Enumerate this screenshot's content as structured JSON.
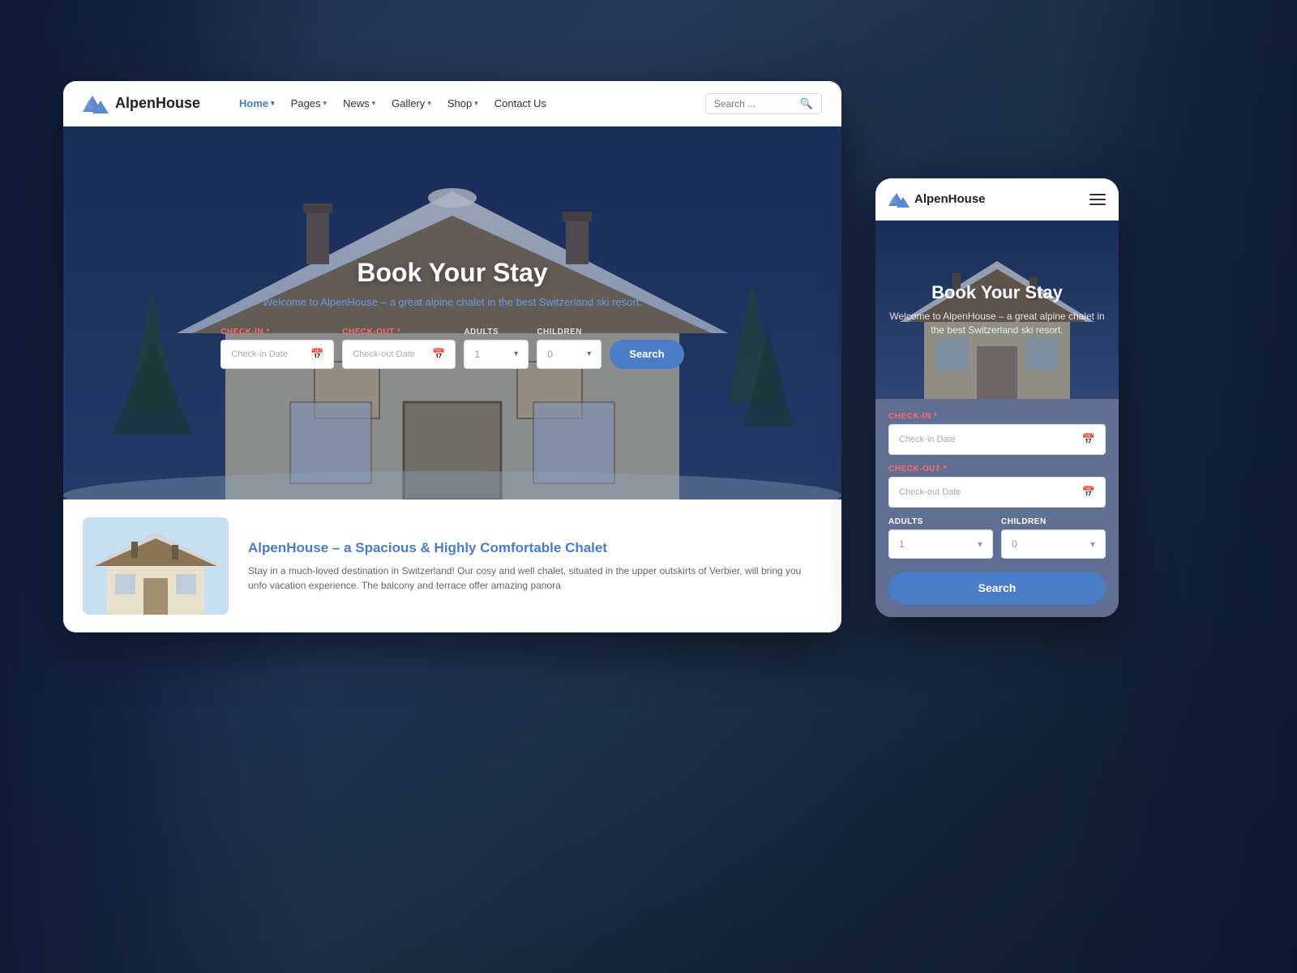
{
  "background": {
    "color": "#1a2a4a"
  },
  "brand": {
    "name": "AlpenHouse",
    "logo_alt": "AlpenHouse mountain logo"
  },
  "desktop": {
    "nav": {
      "links": [
        {
          "label": "Home",
          "has_chevron": true,
          "active": true
        },
        {
          "label": "Pages",
          "has_chevron": true,
          "active": false
        },
        {
          "label": "News",
          "has_chevron": true,
          "active": false
        },
        {
          "label": "Gallery",
          "has_chevron": true,
          "active": false
        },
        {
          "label": "Shop",
          "has_chevron": true,
          "active": false
        },
        {
          "label": "Contact Us",
          "has_chevron": false,
          "active": false
        }
      ],
      "search_placeholder": "Search ..."
    },
    "hero": {
      "title": "Book Your Stay",
      "subtitle": "Welcome to",
      "subtitle_brand": "AlpenHouse",
      "subtitle_rest": " – a great alpine chalet in the best Switzerland ski resort."
    },
    "booking_form": {
      "checkin_label": "CHECK-IN",
      "checkin_required": "*",
      "checkin_placeholder": "Check-in Date",
      "checkout_label": "CHECK-OUT",
      "checkout_required": "*",
      "checkout_placeholder": "Check-out Date",
      "adults_label": "ADULTS",
      "adults_default": "1",
      "children_label": "CHILDREN",
      "children_default": "0",
      "search_button": "Search"
    },
    "chalet_section": {
      "title": "AlpenHouse – a Spacious & Highly Comfortable Chalet",
      "description": "Stay in a much-loved destination in Switzerland! Our cosy and well chalet, situated in the upper outskirts of Verbier, will bring you unfo vacation experience. The balcony and terrace offer amazing panora"
    }
  },
  "mobile": {
    "nav": {
      "brand_name": "AlpenHouse",
      "menu_icon": "hamburger"
    },
    "hero": {
      "title": "Book Your Stay",
      "subtitle": "Welcome to AlpenHouse – a great alpine chalet in the best Switzerland ski resort."
    },
    "booking_form": {
      "checkin_label": "CHECK-IN",
      "checkin_required": "*",
      "checkin_placeholder": "Check-in Date",
      "checkout_label": "CHECK-OUT",
      "checkout_required": "*",
      "checkout_placeholder": "Check-out Date",
      "adults_label": "ADULTS",
      "adults_default": "1",
      "children_label": "CHILDREN",
      "children_default": "0",
      "search_button": "Search"
    }
  },
  "colors": {
    "primary": "#4a7cc7",
    "accent": "#6a9de0",
    "background_dark": "#1a2a4a",
    "white": "#ffffff",
    "text_dark": "#222222",
    "text_light": "#666666",
    "required_star": "#ff6b6b"
  }
}
